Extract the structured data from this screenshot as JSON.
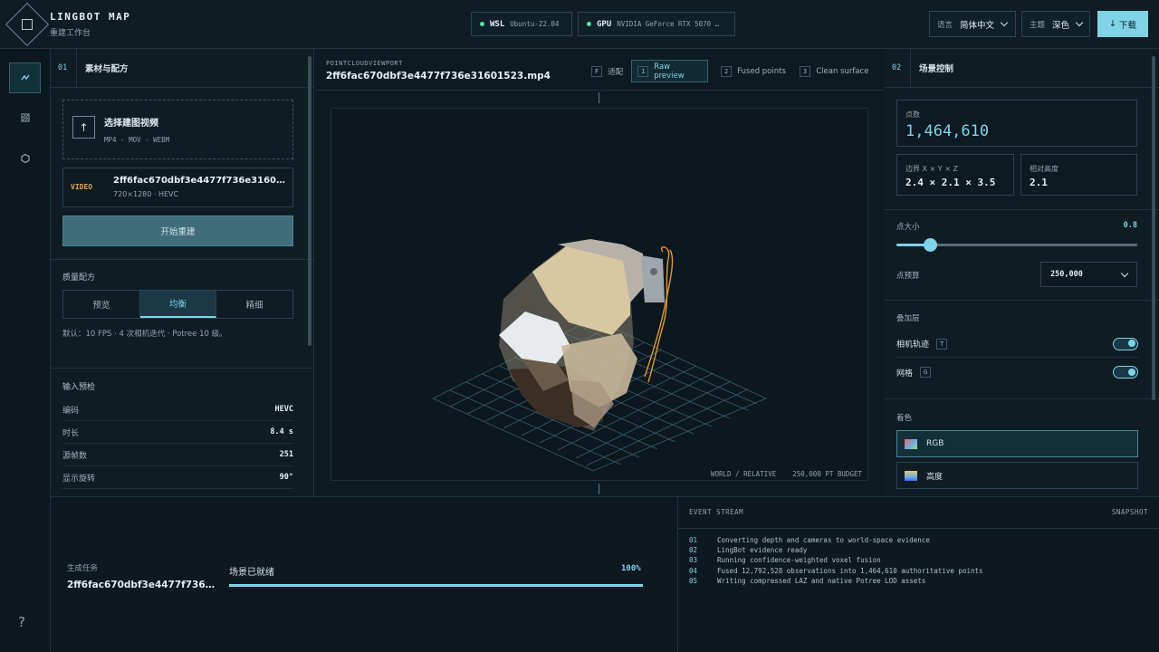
{
  "header": {
    "brand_title": "LINGBOT MAP",
    "brand_subtitle": "重建工作台",
    "wsl": {
      "label": "WSL",
      "value": "Ubuntu-22.04"
    },
    "gpu": {
      "label": "GPU",
      "value": "NVIDIA GeForce RTX 5070 …"
    },
    "language": {
      "label": "语言",
      "value": "简体中文"
    },
    "theme": {
      "label": "主题",
      "value": "深色"
    },
    "download_label": "下载",
    "status_color": "#5fe0a8",
    "accent_color": "#7fd4e8"
  },
  "rail": {
    "icons": [
      "route-icon",
      "image-icon",
      "hexagon-icon"
    ],
    "help": "?"
  },
  "left_panel": {
    "section_num": "01",
    "section_title": "素材与配方",
    "upload": {
      "title": "选择建图视频",
      "formats": "MP4 · MOV · WEBM"
    },
    "video": {
      "tag": "VIDEO",
      "name": "2ff6fac670dbf3e4477f736e31601523.mp4",
      "meta": "720×1280 · HEVC"
    },
    "start_button": "开始重建",
    "quality": {
      "title": "质量配方",
      "options": [
        "预览",
        "均衡",
        "精细"
      ],
      "selected": "均衡",
      "note": "默认：10 FPS · 4 次相机迭代 · Potree 10 级。"
    },
    "precheck": {
      "title": "输入预检",
      "rows": [
        {
          "k": "编码",
          "v": "HEVC"
        },
        {
          "k": "时长",
          "v": "8.4 s"
        },
        {
          "k": "源帧数",
          "v": "251"
        },
        {
          "k": "显示旋转",
          "v": "90°"
        }
      ]
    }
  },
  "viewport": {
    "label": "POINTCLOUDVIEWPORT",
    "file": "2ff6fac670dbf3e4477f736e31601523.mp4",
    "fit": {
      "key": "F",
      "label": "适配"
    },
    "modes": [
      {
        "key": "1",
        "label": "Raw preview",
        "active": true
      },
      {
        "key": "2",
        "label": "Fused points",
        "active": false
      },
      {
        "key": "3",
        "label": "Clean surface",
        "active": false
      }
    ],
    "footer_space": "WORLD / RELATIVE",
    "footer_budget": "250,000 PT BUDGET"
  },
  "right_panel": {
    "section_num": "02",
    "section_title": "场景控制",
    "points": {
      "label": "点数",
      "value": "1,464,610"
    },
    "bounds": {
      "label": "边界 X × Y × Z",
      "value": "2.4 × 2.1 × 3.5"
    },
    "height": {
      "label": "相对高度",
      "value": "2.1"
    },
    "point_size": {
      "label": "点大小",
      "value": "0.8",
      "fraction": 0.14
    },
    "budget": {
      "label": "点预算",
      "value": "250,000"
    },
    "overlay": {
      "title": "叠加层",
      "items": [
        {
          "label": "相机轨迹",
          "key": "T",
          "on": true
        },
        {
          "label": "网格",
          "key": "G",
          "on": true
        }
      ]
    },
    "coloring": {
      "title": "着色",
      "options": [
        {
          "label": "RGB",
          "active": true
        },
        {
          "label": "高度",
          "active": false
        }
      ]
    }
  },
  "bottom": {
    "task_label": "生成任务",
    "task_name": "2ff6fac670dbf3e4477f736…",
    "stage": "场景已就绪",
    "percent_label": "100%",
    "progress": 1.0
  },
  "events": {
    "title": "EVENT STREAM",
    "snapshot": "SNAPSHOT",
    "rows": [
      {
        "n": "01",
        "text": "Converting depth and cameras to world-space evidence"
      },
      {
        "n": "02",
        "text": "LingBot evidence ready"
      },
      {
        "n": "03",
        "text": "Running confidence-weighted voxel fusion"
      },
      {
        "n": "04",
        "text": "Fused 12,792,528 observations into 1,464,610 authoritative points"
      },
      {
        "n": "05",
        "text": "Writing compressed LAZ and native Potree LOD assets"
      }
    ]
  }
}
